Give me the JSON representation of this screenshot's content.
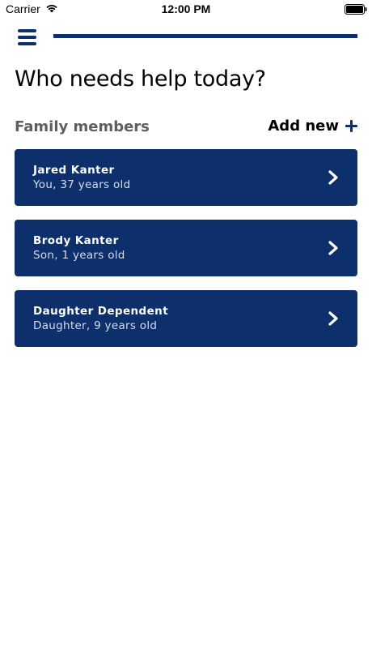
{
  "status_bar": {
    "carrier": "Carrier",
    "time": "12:00 PM",
    "wifi_icon": "wifi-icon",
    "battery_icon": "battery-icon"
  },
  "nav": {
    "menu_icon": "hamburger-menu-icon",
    "progress": 1.0
  },
  "title": "Who needs help today?",
  "section": {
    "title": "Family members",
    "add_label": "Add new",
    "add_icon": "plus-icon"
  },
  "members": [
    {
      "name": "Jared Kanter",
      "detail": "You, 37 years old",
      "icon": "chevron-right-icon"
    },
    {
      "name": "Brody Kanter",
      "detail": "Son, 1 years old",
      "icon": "chevron-right-icon"
    },
    {
      "name": "Daughter Dependent",
      "detail": "Daughter, 9 years old",
      "icon": "chevron-right-icon"
    }
  ],
  "colors": {
    "brand": "#0d2f6b",
    "card_text": "#ffffff",
    "card_subtext": "#d6dceb",
    "section_title": "#5f5f5f"
  }
}
